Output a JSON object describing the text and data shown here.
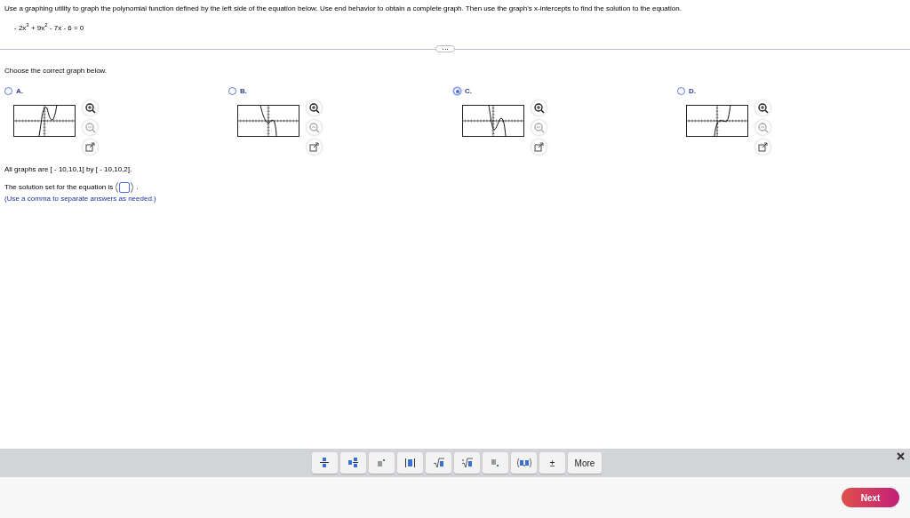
{
  "question": {
    "instruction": "Use a graphing utility to graph the polynomial function defined by the left side of the equation below. Use end behavior to obtain a complete graph. Then use the graph's x-intercepts to find the solution to the equation.",
    "equation": "- 2x$^{3}$ + 9x$^{2}$ - 7x - 6 = 0"
  },
  "prompt": "Choose the correct graph below.",
  "options": [
    {
      "label": "A.",
      "selected": false
    },
    {
      "label": "B.",
      "selected": false
    },
    {
      "label": "C.",
      "selected": true
    },
    {
      "label": "D.",
      "selected": false
    }
  ],
  "window_note": "All graphs are [ - 10,10,1] by [ - 10,10,2].",
  "answer": {
    "before": "The solution set for the equation is",
    "after": ".",
    "hint": "(Use a comma to separate answers as needed.)"
  },
  "palette": [
    {
      "kind": "fraction"
    },
    {
      "kind": "mixed"
    },
    {
      "kind": "exponent"
    },
    {
      "kind": "abs"
    },
    {
      "kind": "sqrt"
    },
    {
      "kind": "nthroot"
    },
    {
      "kind": "subscript"
    },
    {
      "kind": "interval"
    },
    {
      "kind": "text",
      "label": "±"
    },
    {
      "kind": "text",
      "label": "More"
    }
  ],
  "next_button": "Next"
}
